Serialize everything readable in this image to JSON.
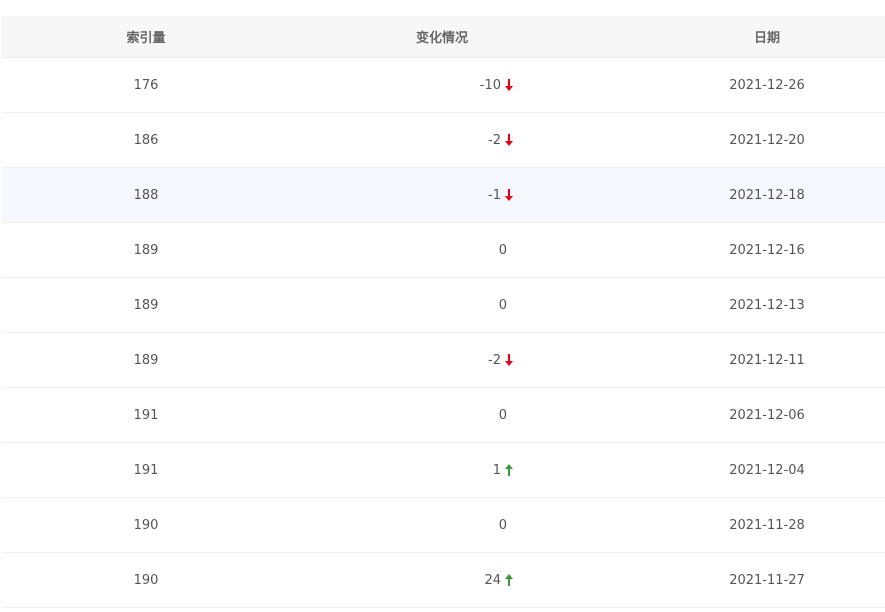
{
  "table": {
    "headers": {
      "index": "索引量",
      "change": "变化情况",
      "date": "日期"
    },
    "rows": [
      {
        "index": "176",
        "change": "-10",
        "direction": "down",
        "date": "2021-12-26"
      },
      {
        "index": "186",
        "change": "-2",
        "direction": "down",
        "date": "2021-12-20"
      },
      {
        "index": "188",
        "change": "-1",
        "direction": "down",
        "date": "2021-12-18",
        "highlighted": true
      },
      {
        "index": "189",
        "change": "0",
        "direction": "none",
        "date": "2021-12-16"
      },
      {
        "index": "189",
        "change": "0",
        "direction": "none",
        "date": "2021-12-13"
      },
      {
        "index": "189",
        "change": "-2",
        "direction": "down",
        "date": "2021-12-11"
      },
      {
        "index": "191",
        "change": "0",
        "direction": "none",
        "date": "2021-12-06"
      },
      {
        "index": "191",
        "change": "1",
        "direction": "up",
        "date": "2021-12-04"
      },
      {
        "index": "190",
        "change": "0",
        "direction": "none",
        "date": "2021-11-28"
      },
      {
        "index": "190",
        "change": "24",
        "direction": "up",
        "date": "2021-11-27"
      }
    ],
    "colors": {
      "down": "#e60012",
      "up": "#3a9a3a",
      "highlight_row": "#f5f8ff"
    }
  }
}
